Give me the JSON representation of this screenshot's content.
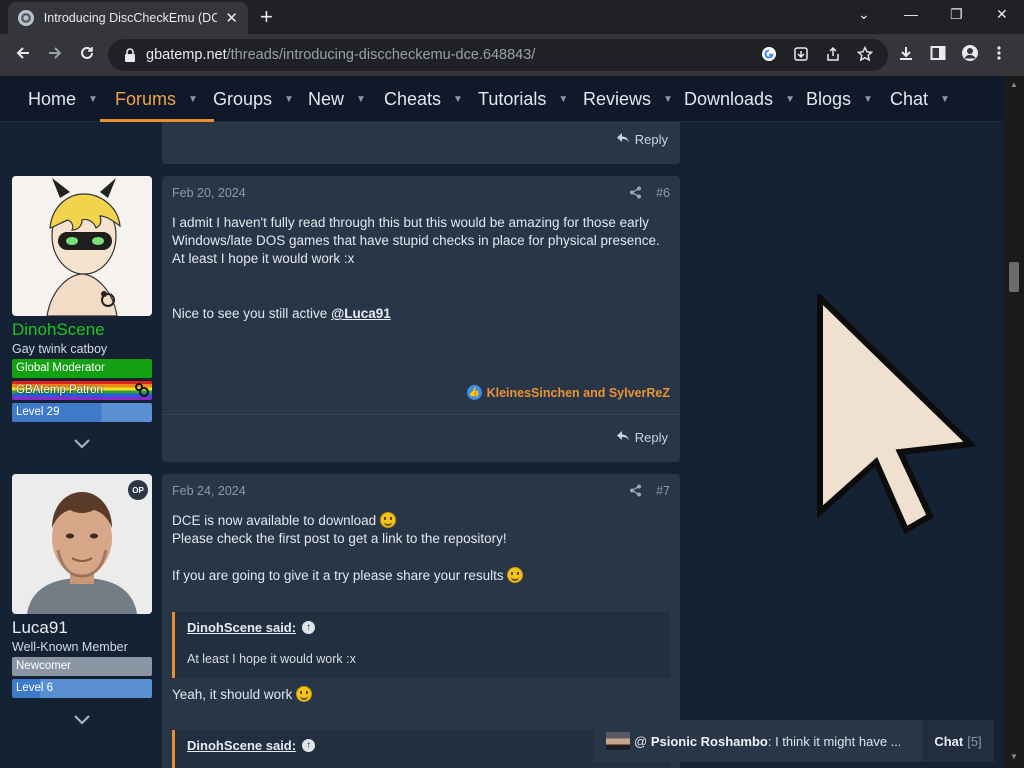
{
  "browser": {
    "tab_title": "Introducing DiscCheckEmu (DCE)",
    "tab_close": "✕",
    "new_tab": "+",
    "url_host": "gbatemp.net",
    "url_path": "/threads/introducing-disccheckemu-dce.648843/",
    "window_minimize": "—",
    "window_restore": "❐",
    "window_close": "✕",
    "window_tabsearch": "⌄"
  },
  "site_nav": {
    "items": [
      {
        "label": "Home"
      },
      {
        "label": "Forums"
      },
      {
        "label": "Groups"
      },
      {
        "label": "New"
      },
      {
        "label": "Cheats"
      },
      {
        "label": "Tutorials"
      },
      {
        "label": "Reviews"
      },
      {
        "label": "Downloads"
      },
      {
        "label": "Blogs"
      },
      {
        "label": "Chat"
      }
    ],
    "active": "Forums",
    "accent_color": "#e98e2b"
  },
  "reply_label": "Reply",
  "posts": [
    {
      "date": "Feb 20, 2024",
      "number": "#6",
      "author": {
        "name": "DinohScene",
        "name_color": "#1ec41e",
        "title": "Gay twink catboy",
        "banners": [
          "Global Moderator",
          "GBAtemp Patron",
          "Level 29"
        ]
      },
      "body": {
        "line1": "I admit I haven't fully read through this but this would be amazing for those early",
        "line2": "Windows/late DOS games that have stupid checks in place for physical presence.",
        "line3": "At least I hope it would work :x",
        "line4_prefix": "Nice to see you still active ",
        "mention": "@Luca91"
      },
      "reactions": "KleinesSinchen and SylverReZ"
    },
    {
      "date": "Feb 24, 2024",
      "number": "#7",
      "op_badge": "OP",
      "author": {
        "name": "Luca91",
        "title": "Well-Known Member",
        "banners": [
          "Newcomer",
          "Level 6"
        ]
      },
      "body": {
        "line1": "DCE is now available to download",
        "line2": "Please check the first post to get a link to the repository!",
        "line3": "If you are going to give it a try please share your results",
        "quote1_author": "DinohScene said:",
        "quote1_text": "At least I hope it would work :x",
        "after_quote": "Yeah, it should work",
        "quote2_author": "DinohScene said:"
      }
    }
  ],
  "chat": {
    "prefix": "@ ",
    "user": "Psionic Roshambo",
    "message": ": I think it might have ...",
    "label": "Chat",
    "count": "[5]"
  }
}
